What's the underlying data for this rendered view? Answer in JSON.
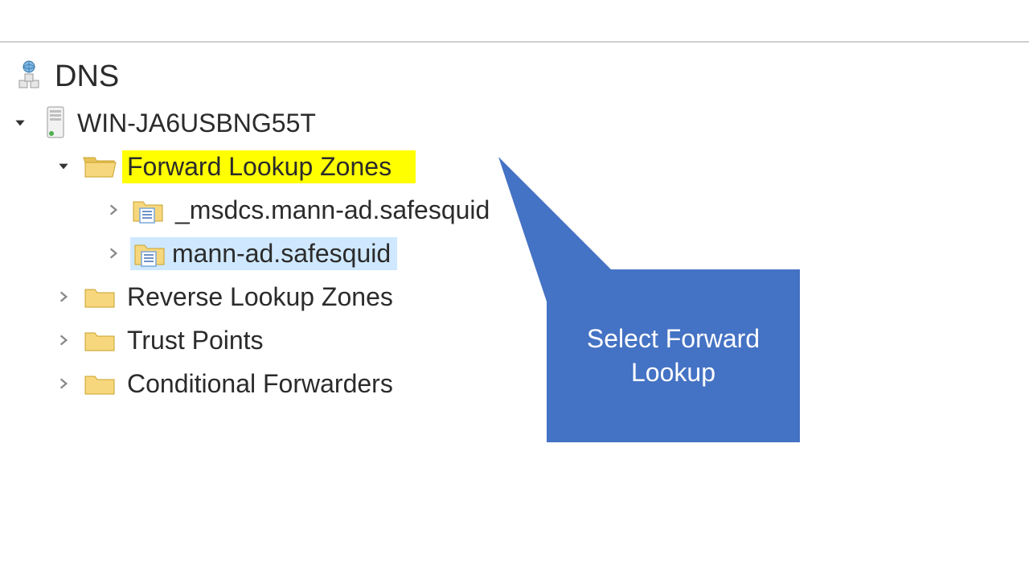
{
  "tree": {
    "root_label": "DNS",
    "server_label": "WIN-JA6USBNG55T",
    "fwd_zones_label": "Forward Lookup Zones",
    "zone_msdcs_label": "_msdcs.mann-ad.safesquid",
    "zone_mann_label": "mann-ad.safesquid",
    "rev_zones_label": "Reverse Lookup Zones",
    "trust_label": "Trust Points",
    "cond_fwd_label": "Conditional Forwarders"
  },
  "callout": {
    "text_line1": "Select Forward",
    "text_line2": "Lookup"
  }
}
